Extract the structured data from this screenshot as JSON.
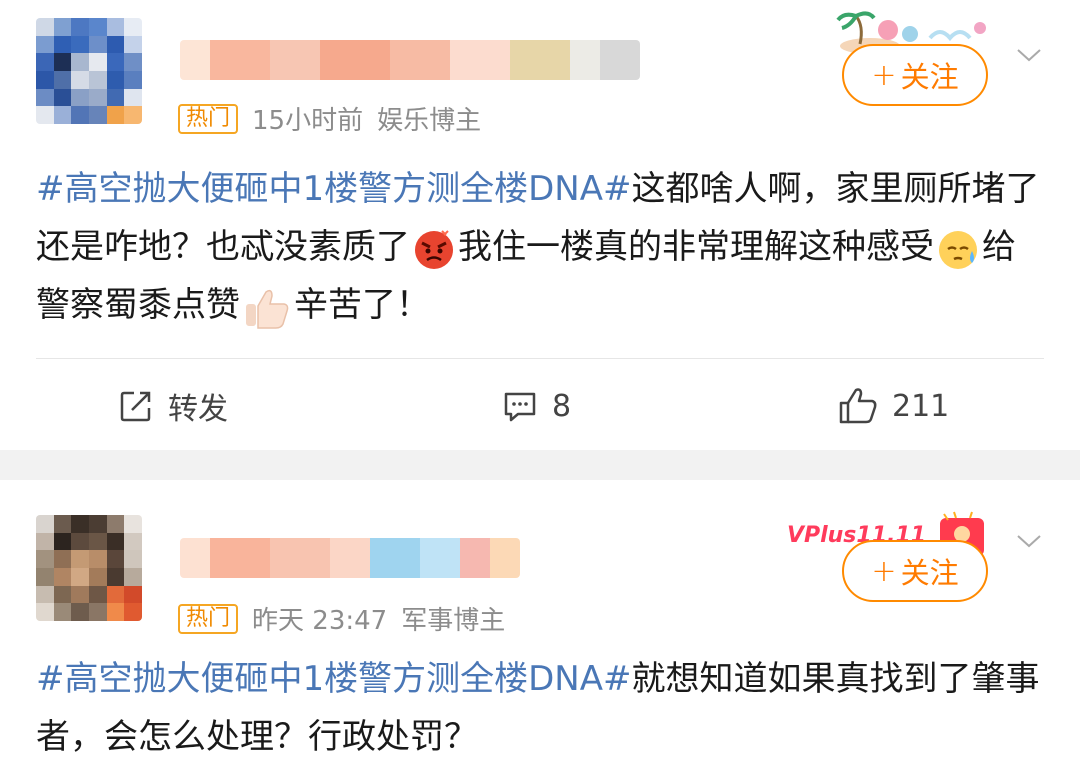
{
  "posts": [
    {
      "hot_badge": "热门",
      "time": "15小时前",
      "author_tag": "娱乐博主",
      "follow_label": "关注",
      "hashtag": "#高空抛大便砸中1楼警方测全楼DNA#",
      "text_part1": "这都啥人啊，家里厕所堵了还是咋地？也忒没素质了",
      "text_part2": "我住一楼真的非常理解这种感受",
      "text_part3": "给警察蜀黍点赞",
      "text_part4": "辛苦了！",
      "actions": {
        "repost_label": "转发",
        "comment_count": "8",
        "like_count": "211"
      }
    },
    {
      "hot_badge": "热门",
      "time": "昨天 23:47",
      "author_tag": "军事博主",
      "follow_label": "关注",
      "vip_badge": "VPlus11.11",
      "hashtag": "#高空抛大便砸中1楼警方测全楼DNA#",
      "text": "就想知道如果真找到了肇事者，会怎么处理？行政处罚？"
    }
  ],
  "colors": {
    "hashtag": "#4a77b6",
    "follow": "#ff7b00",
    "hot_badge": "#f08a00",
    "meta": "#8c8c8c",
    "separator": "#f2f2f2"
  },
  "icons": [
    "repost-icon",
    "comment-icon",
    "like-icon",
    "chevron-down-icon",
    "angry-emoji-icon",
    "sweat-emoji-icon",
    "thumbs-up-emoji-icon"
  ]
}
